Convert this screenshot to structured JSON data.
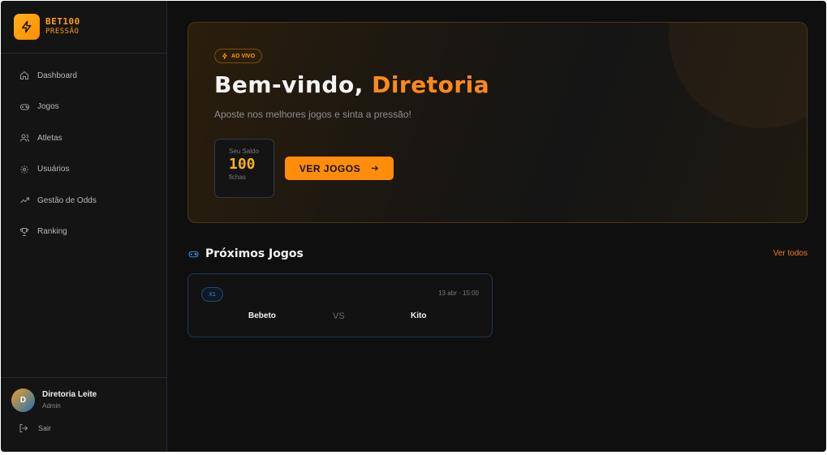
{
  "brand": {
    "name": "BET100",
    "subtitle": "PRESSÃO"
  },
  "sidebar": {
    "items": [
      {
        "label": "Dashboard",
        "icon": "home-icon"
      },
      {
        "label": "Jogos",
        "icon": "gamepad-icon"
      },
      {
        "label": "Atletas",
        "icon": "users-icon"
      },
      {
        "label": "Usuários",
        "icon": "gear-icon"
      },
      {
        "label": "Gestão de Odds",
        "icon": "trending-up-icon"
      },
      {
        "label": "Ranking",
        "icon": "trophy-icon"
      }
    ]
  },
  "user": {
    "initial": "D",
    "name": "Diretoria Leite",
    "role": "Admin",
    "logout_label": "Sair"
  },
  "hero": {
    "badge": "AO VIVO",
    "title_prefix": "Bem-vindo, ",
    "title_name": "Diretoria",
    "subtitle": "Aposte nos melhores jogos e sinta a pressão!",
    "balance_label": "Seu Saldo",
    "balance_value": "100",
    "balance_unit": "fichas",
    "cta_label": "VER JOGOS"
  },
  "upcoming": {
    "title": "Próximos Jogos",
    "see_all": "Ver todos",
    "matches": [
      {
        "badge": "X1",
        "time": "13 abr · 15:00",
        "team_a": "Bebeto",
        "vs": "VS",
        "team_b": "Kito"
      }
    ]
  },
  "colors": {
    "accent": "#ff8c0a",
    "accent_gold": "#ffb21a",
    "link": "#ff7a1a",
    "badge_blue": "#3a8ee0",
    "background": "#0f0f0f"
  }
}
